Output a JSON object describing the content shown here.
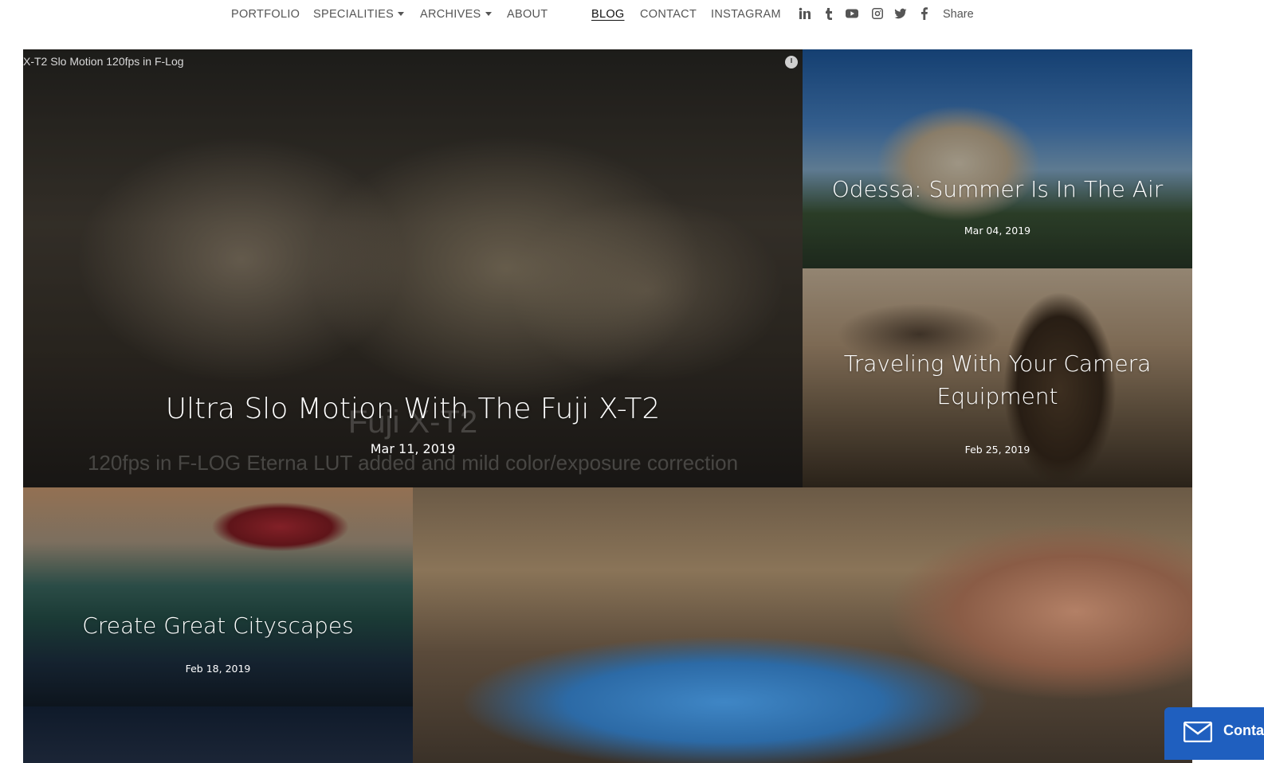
{
  "nav": {
    "items": [
      {
        "label": "PORTFOLIO"
      },
      {
        "label": "SPECIALITIES"
      },
      {
        "label": "ARCHIVES"
      },
      {
        "label": "ABOUT"
      },
      {
        "label": "BLOG"
      },
      {
        "label": "CONTACT"
      },
      {
        "label": "INSTAGRAM"
      }
    ],
    "social": [
      "linkedin-icon",
      "tumblr-icon",
      "youtube-icon",
      "instagram-icon",
      "twitter-icon",
      "facebook-icon"
    ],
    "share_label": "Share"
  },
  "posts": [
    {
      "title": "Ultra Slo Motion With The Fuji X-T2",
      "date": "Mar 11, 2019",
      "video_caption": "X-T2 Slo Motion 120fps in F-Log",
      "video_watermark": "Fuji X-T2",
      "video_subtitle": "120fps in F-LOG Eterna LUT added and mild color/exposure correction"
    },
    {
      "title": "Odessa: Summer Is In The Air",
      "date": "Mar 04, 2019"
    },
    {
      "title": "Traveling With Your Camera Equipment",
      "date": "Feb 25, 2019"
    },
    {
      "title": "Create Great Cityscapes",
      "date": "Feb 18, 2019"
    }
  ],
  "contact_widget": {
    "label": "Conta",
    "icon": "envelope-icon"
  },
  "colors": {
    "accent": "#1f5fbf",
    "nav_text": "#555555"
  }
}
